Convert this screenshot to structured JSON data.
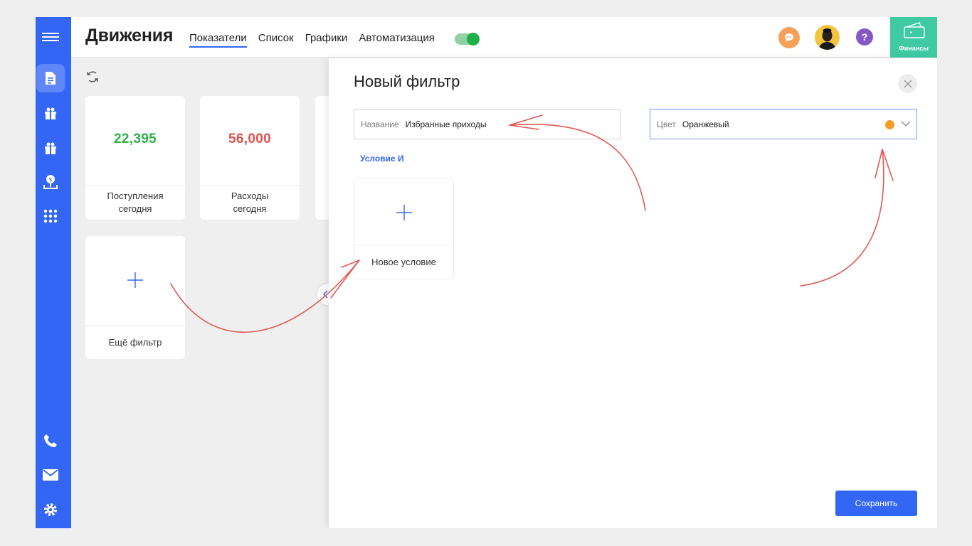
{
  "header": {
    "title": "Движения",
    "tabs": [
      {
        "label": "Показатели",
        "active": true
      },
      {
        "label": "Список",
        "active": false
      },
      {
        "label": "Графики",
        "active": false
      },
      {
        "label": "Автоматизация",
        "active": false
      }
    ],
    "automation_toggle_on": true,
    "help_label": "?",
    "finance_label": "Финансы"
  },
  "sidebar": {
    "items": [
      {
        "icon": "menu-icon"
      },
      {
        "icon": "document-icon",
        "active": true
      },
      {
        "icon": "gift-icon"
      },
      {
        "icon": "gift-icon"
      },
      {
        "icon": "money-download-icon"
      },
      {
        "icon": "apps-grid-icon"
      }
    ],
    "bottom_items": [
      {
        "icon": "phone-icon"
      },
      {
        "icon": "mail-icon"
      },
      {
        "icon": "gear-icon"
      }
    ]
  },
  "cards": [
    {
      "value": "22,395",
      "caption_line1": "Поступления",
      "caption_line2": "сегодня",
      "color": "#2db34a"
    },
    {
      "value": "56,000",
      "caption_line1": "Расходы",
      "caption_line2": "сегодня",
      "color": "#e0504f"
    },
    {
      "caption": "Ещё фильтр"
    }
  ],
  "modal": {
    "title": "Новый фильтр",
    "name_field": {
      "label": "Название",
      "value": "Избранные приходы"
    },
    "color_field": {
      "label": "Цвет",
      "value": "Оранжевый",
      "swatch": "#f79a2c"
    },
    "condition_link": "Условие И",
    "new_condition_label": "Новое условие",
    "save_label": "Сохранить"
  },
  "colors": {
    "accent": "#3366f5",
    "finance": "#3fcaa4",
    "annotation": "#e05a55"
  }
}
